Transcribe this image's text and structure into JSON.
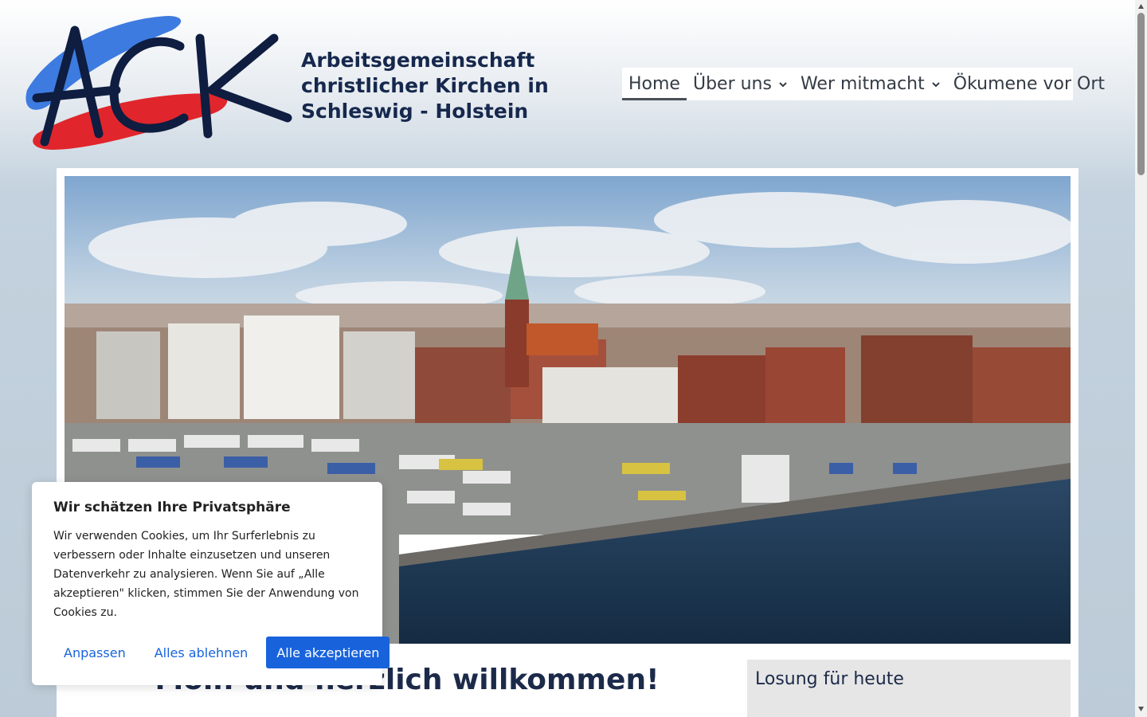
{
  "header": {
    "logo": {
      "monogram": "ACK",
      "lines": [
        "Arbeitsgemeinschaft",
        "christlicher Kirchen in",
        "Schleswig - Holstein"
      ]
    },
    "nav": [
      {
        "label": "Home",
        "active": true,
        "has_dropdown": false
      },
      {
        "label": "Über uns",
        "active": false,
        "has_dropdown": true
      },
      {
        "label": "Wer mitmacht",
        "active": false,
        "has_dropdown": true
      },
      {
        "label": "Ökumene vor Ort",
        "active": false,
        "has_dropdown": false
      }
    ]
  },
  "hero": {
    "image": "harbor-city-panorama"
  },
  "main": {
    "heading": "Moin und herzlich willkommen!",
    "sidebar_title": "Losung für heute"
  },
  "cookie_banner": {
    "title": "Wir schätzen Ihre Privatsphäre",
    "text": "Wir verwenden Cookies, um Ihr Surferlebnis zu verbessern oder Inhalte einzusetzen und unseren Datenverkehr zu analysieren. Wenn Sie auf „Alle akzeptieren\" klicken, stimmen Sie der Anwendung von Cookies zu.",
    "buttons": {
      "customize": "Anpassen",
      "reject": "Alles ablehnen",
      "accept": "Alle akzeptieren"
    }
  },
  "colors": {
    "brand_navy": "#16284d",
    "accept_button": "#1863dc",
    "logo_blue": "#3d7be0",
    "logo_red": "#e0262c"
  }
}
